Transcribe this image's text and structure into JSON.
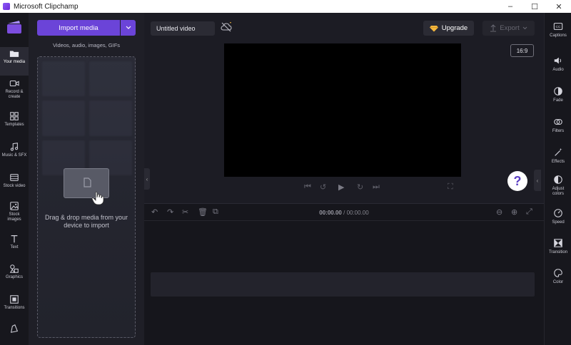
{
  "window": {
    "title": "Microsoft Clipchamp",
    "minimize": "–",
    "maximize": "☐",
    "close": "✕"
  },
  "nav": {
    "items": [
      {
        "label": "Your media",
        "icon": "folder-icon"
      },
      {
        "label": "Record & create",
        "icon": "camera-icon"
      },
      {
        "label": "Templates",
        "icon": "templates-icon"
      },
      {
        "label": "Music & SFX",
        "icon": "music-icon"
      },
      {
        "label": "Stock video",
        "icon": "film-icon"
      },
      {
        "label": "Stock images",
        "icon": "image-icon"
      },
      {
        "label": "Text",
        "icon": "text-icon"
      },
      {
        "label": "Graphics",
        "icon": "shapes-icon"
      },
      {
        "label": "Transitions",
        "icon": "transitions-icon"
      },
      {
        "label": "Brand kit",
        "icon": "brand-icon"
      }
    ]
  },
  "media": {
    "import_label": "Import media",
    "subtitle": "Videos, audio, images, GIFs",
    "drop_text": "Drag & drop media from your device to import"
  },
  "topbar": {
    "project_title": "Untitled video",
    "upgrade_label": "Upgrade",
    "export_label": "Export",
    "aspect_ratio": "16:9"
  },
  "help": {
    "label": "?"
  },
  "timeline": {
    "current_time": "00:00.00",
    "separator": " / ",
    "total_time": "00:00.00"
  },
  "right_panel": {
    "items": [
      {
        "label": "Captions",
        "icon": "captions-icon"
      },
      {
        "label": "Audio",
        "icon": "speaker-icon"
      },
      {
        "label": "Fade",
        "icon": "fade-icon"
      },
      {
        "label": "Filters",
        "icon": "filters-icon"
      },
      {
        "label": "Effects",
        "icon": "magic-wand-icon"
      },
      {
        "label": "Adjust colors",
        "icon": "adjust-icon"
      },
      {
        "label": "Speed",
        "icon": "speedometer-icon"
      },
      {
        "label": "Transition",
        "icon": "transition-icon"
      },
      {
        "label": "Color",
        "icon": "palette-icon"
      }
    ]
  },
  "colors": {
    "accent": "#6b44d8",
    "background": "#1c1c24",
    "panel": "#17171d"
  }
}
